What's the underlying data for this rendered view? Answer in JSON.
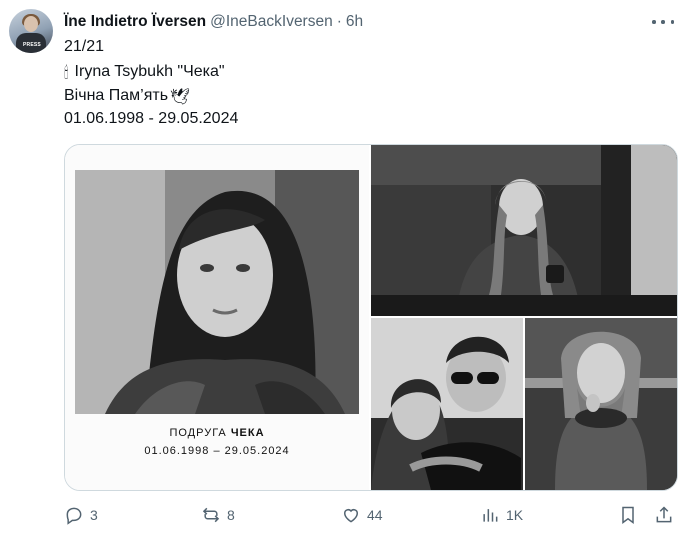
{
  "tweet": {
    "display_name": "Ïne Indietro Ïversen",
    "handle": "@IneBackIversen",
    "separator": "·",
    "time": "6h",
    "lines": [
      "21/21",
      "Iryna Tsybukh \"Чека\"",
      "Вічна Пам’ять",
      "01.06.1998 - 29.05.2024"
    ],
    "emoji_candle": "🕯",
    "emoji_dove": "🕊"
  },
  "avatar": {
    "badge": "PRESS"
  },
  "media": {
    "card_caption_prefix": "ПОДРУГА",
    "card_caption_name": "ЧЕКА",
    "card_dates": "01.06.1998 – 29.05.2024"
  },
  "actions": {
    "replies": "3",
    "reposts": "8",
    "likes": "44",
    "views": "1K"
  },
  "icons": [
    "more-icon",
    "reply-icon",
    "repost-icon",
    "like-icon",
    "views-icon",
    "bookmark-icon",
    "share-icon"
  ],
  "colors": {
    "text": "#0f1419",
    "muted": "#536471",
    "border": "#cfd9de"
  }
}
